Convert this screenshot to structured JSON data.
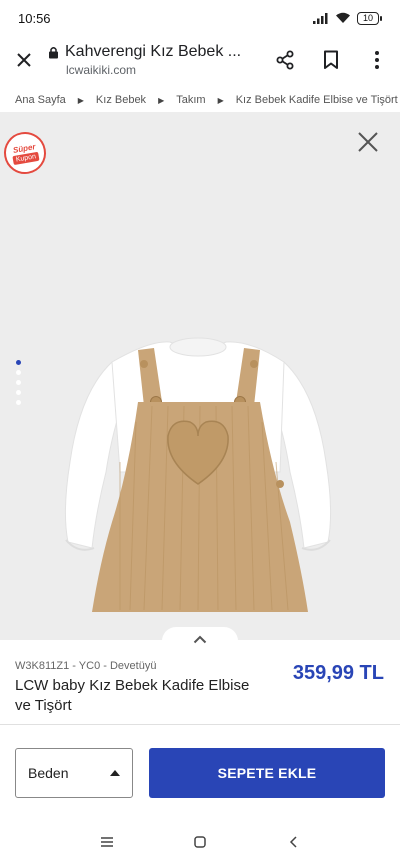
{
  "status_bar": {
    "time": "10:56",
    "battery": "10"
  },
  "browser": {
    "page_title": "Kahverengi Kız Bebek ...",
    "domain": "lcwaikiki.com"
  },
  "breadcrumb": {
    "items": [
      "Ana Sayfa",
      "Kız Bebek",
      "Takım",
      "Kız Bebek Kadife Elbise ve Tişört"
    ]
  },
  "gallery": {
    "badge_top": "Süper",
    "badge_bottom": "Kupon",
    "image_count": 5,
    "active_index": 0
  },
  "product": {
    "code": "W3K811Z1 - YC0 - Devetüyü",
    "name": "LCW baby Kız Bebek Kadife Elbise ve Tişört",
    "price": "359,99 TL"
  },
  "actions": {
    "size_label": "Beden",
    "add_to_cart_label": "SEPETE EKLE"
  },
  "colors": {
    "accent": "#2945b6",
    "badge_red": "#e44a3f",
    "image_background": "#ededed",
    "garment_corduroy": "#c9a578",
    "garment_shirt": "#ffffff"
  }
}
